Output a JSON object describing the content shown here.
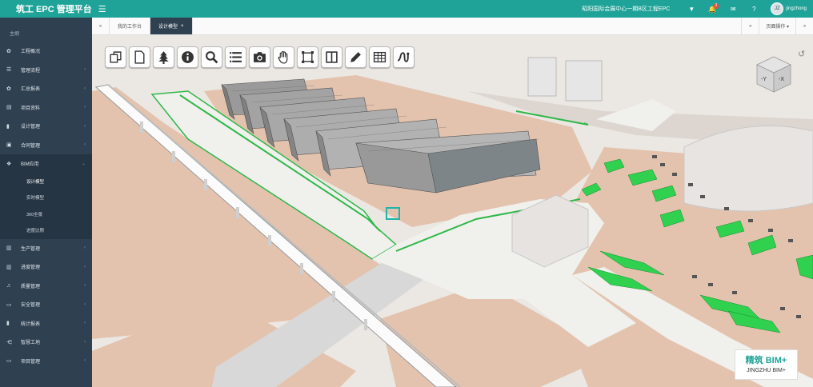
{
  "header": {
    "brand": "筑工 EPC 管理平台",
    "menu_icon": "hamburger-icon",
    "project": "昭阳国际会展中心一期B区工程EPC",
    "notification_count": "3",
    "avatar_text": "JZ",
    "username": "jingzhong",
    "icons": [
      "filter-icon",
      "bell-icon",
      "mail-icon",
      "help-icon"
    ]
  },
  "sidebar": {
    "section": "主纲",
    "items": [
      {
        "label": "工程概况",
        "icon": "gear-icon"
      },
      {
        "label": "管理流程",
        "icon": "flow-icon"
      },
      {
        "label": "汇总报表",
        "icon": "gear-icon"
      },
      {
        "label": "项目资料",
        "icon": "file-icon"
      },
      {
        "label": "设计管理",
        "icon": "book-icon"
      },
      {
        "label": "合同管理",
        "icon": "briefcase-icon"
      },
      {
        "label": "BIM应用",
        "icon": "cubes-icon"
      }
    ],
    "subitems": [
      "设计模型",
      "实时模型",
      "360全景",
      "进度比照"
    ],
    "items_after": [
      {
        "label": "生产管理",
        "icon": "bank-icon"
      },
      {
        "label": "进度管理",
        "icon": "bank-icon"
      },
      {
        "label": "质量管理",
        "icon": "bell-icon"
      },
      {
        "label": "安全管理",
        "icon": "monitor-icon"
      },
      {
        "label": "统计报表",
        "icon": "bar-chart-icon"
      },
      {
        "label": "智慧工地",
        "icon": "share-icon"
      },
      {
        "label": "项目管理",
        "icon": "monitor-icon"
      }
    ]
  },
  "tabs": {
    "prev": "«",
    "next": "»",
    "items": [
      "我的工作台",
      "设计模型"
    ],
    "close": "×",
    "page_ops": "页面操作 ▾"
  },
  "viewer": {
    "tools": [
      "clone-icon",
      "document-icon",
      "tree-icon",
      "info-icon",
      "search-icon",
      "list-icon",
      "camera-icon",
      "hand-icon",
      "fit-icon",
      "split-icon",
      "pencil-icon",
      "grid-icon",
      "path-icon"
    ],
    "viewcube_labels": [
      "-Y",
      "-X"
    ],
    "reset_icon": "undo-icon",
    "watermark_cn": "精筑 BIM+",
    "watermark_en": "JINGZHU BIM+"
  },
  "colors": {
    "topbar": "#1fa398",
    "sidebar": "#2f4050",
    "ground": "#e3c3ae",
    "road": "#f0f0ec",
    "grass": "#2fb84a"
  }
}
